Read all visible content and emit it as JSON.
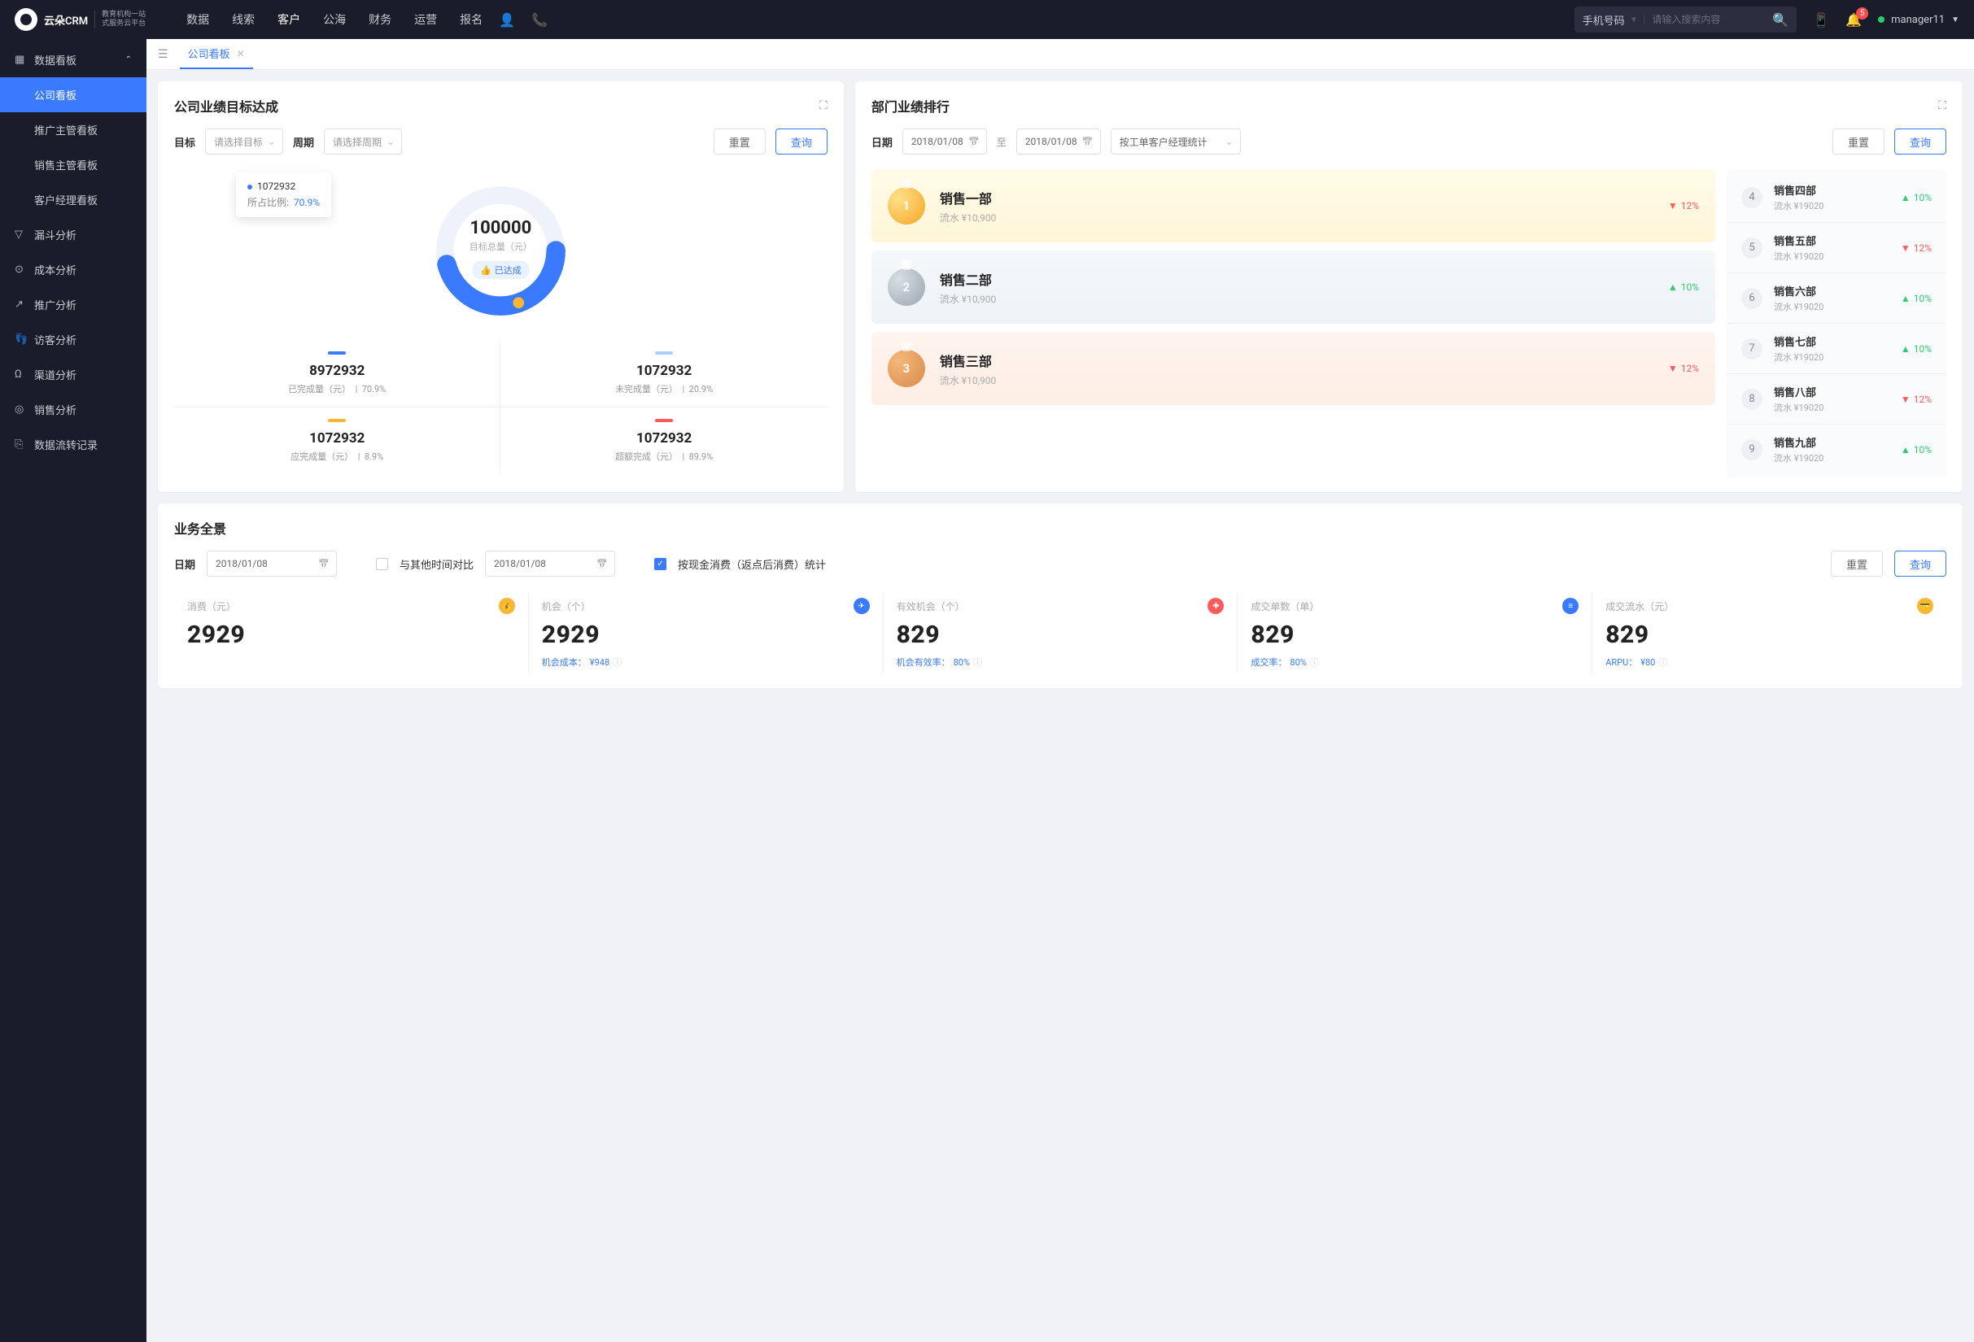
{
  "brand": {
    "name": "云朵CRM",
    "tagline1": "教育机构一站",
    "tagline2": "式服务云平台"
  },
  "topnav": {
    "items": [
      "数据",
      "线索",
      "客户",
      "公海",
      "财务",
      "运营",
      "报名"
    ],
    "activeIndex": 2
  },
  "search": {
    "type": "手机号码",
    "placeholder": "请输入搜索内容"
  },
  "topbar": {
    "notif_count": "5",
    "username": "manager11"
  },
  "sidebar": {
    "group": {
      "label": "数据看板"
    },
    "children": [
      "公司看板",
      "推广主管看板",
      "销售主管看板",
      "客户经理看板"
    ],
    "items": [
      "漏斗分析",
      "成本分析",
      "推广分析",
      "访客分析",
      "渠道分析",
      "销售分析",
      "数据流转记录"
    ],
    "activeChild": 0
  },
  "tabs": {
    "current": "公司看板"
  },
  "panel_target": {
    "title": "公司业绩目标达成",
    "filters": {
      "target_label": "目标",
      "target_ph": "请选择目标",
      "period_label": "周期",
      "period_ph": "请选择周期",
      "reset": "重置",
      "query": "查询"
    },
    "donut": {
      "total": "100000",
      "total_label": "目标总量（元）",
      "badge": "已达成"
    },
    "tooltip": {
      "value": "1072932",
      "ratio_label": "所占比例:",
      "ratio": "70.9%"
    },
    "stats": [
      {
        "value": "8972932",
        "label": "已完成量（元）",
        "pct": "70.9%",
        "color": "#3a7afe"
      },
      {
        "value": "1072932",
        "label": "未完成量（元）",
        "pct": "20.9%",
        "color": "#a9d0ff"
      },
      {
        "value": "1072932",
        "label": "应完成量（元）",
        "pct": "8.9%",
        "color": "#f7b733"
      },
      {
        "value": "1072932",
        "label": "超额完成（元）",
        "pct": "89.9%",
        "color": "#ff5b5b"
      }
    ]
  },
  "panel_rank": {
    "title": "部门业绩排行",
    "filters": {
      "date_label": "日期",
      "date_from": "2018/01/08",
      "date_to": "2018/01/08",
      "sep": "至",
      "mode": "按工单客户经理统计",
      "reset": "重置",
      "query": "查询"
    },
    "top3": [
      {
        "rank": "1",
        "name": "销售一部",
        "sub": "流水 ¥10,900",
        "pct": "12%",
        "dir": "down"
      },
      {
        "rank": "2",
        "name": "销售二部",
        "sub": "流水 ¥10,900",
        "pct": "10%",
        "dir": "up"
      },
      {
        "rank": "3",
        "name": "销售三部",
        "sub": "流水 ¥10,900",
        "pct": "12%",
        "dir": "down"
      }
    ],
    "rest": [
      {
        "rank": "4",
        "name": "销售四部",
        "sub": "流水 ¥19020",
        "pct": "10%",
        "dir": "up"
      },
      {
        "rank": "5",
        "name": "销售五部",
        "sub": "流水 ¥19020",
        "pct": "12%",
        "dir": "down"
      },
      {
        "rank": "6",
        "name": "销售六部",
        "sub": "流水 ¥19020",
        "pct": "10%",
        "dir": "up"
      },
      {
        "rank": "7",
        "name": "销售七部",
        "sub": "流水 ¥19020",
        "pct": "10%",
        "dir": "up"
      },
      {
        "rank": "8",
        "name": "销售八部",
        "sub": "流水 ¥19020",
        "pct": "12%",
        "dir": "down"
      },
      {
        "rank": "9",
        "name": "销售九部",
        "sub": "流水 ¥19020",
        "pct": "10%",
        "dir": "up"
      }
    ]
  },
  "panel_overview": {
    "title": "业务全景",
    "filters": {
      "date_label": "日期",
      "date": "2018/01/08",
      "compare_label": "与其他时间对比",
      "date2": "2018/01/08",
      "opt_label": "按现金消费（返点后消费）统计",
      "reset": "重置",
      "query": "查询"
    },
    "cards": [
      {
        "title": "消费（元）",
        "value": "2929",
        "sub": "",
        "icon": "💰",
        "color": "#f7b733"
      },
      {
        "title": "机会（个）",
        "value": "2929",
        "sub_label": "机会成本：",
        "sub_val": "¥948",
        "icon": "✈",
        "color": "#3a7afe"
      },
      {
        "title": "有效机会（个）",
        "value": "829",
        "sub_label": "机会有效率：",
        "sub_val": "80%",
        "icon": "✚",
        "color": "#ff5b5b"
      },
      {
        "title": "成交单数（单）",
        "value": "829",
        "sub_label": "成交率：",
        "sub_val": "80%",
        "icon": "≡",
        "color": "#3a7afe"
      },
      {
        "title": "成交流水（元）",
        "value": "829",
        "sub_label": "ARPU：",
        "sub_val": "¥80",
        "icon": "💳",
        "color": "#f7b733"
      }
    ]
  },
  "chart_data": {
    "type": "pie",
    "title": "公司业绩目标达成",
    "total_label": "目标总量（元）",
    "total": 100000,
    "series": [
      {
        "name": "已完成量",
        "value": 8972932,
        "pct": 70.9,
        "color": "#3a7afe"
      },
      {
        "name": "未完成量",
        "value": 1072932,
        "pct": 20.9,
        "color": "#a9d0ff"
      },
      {
        "name": "应完成量",
        "value": 1072932,
        "pct": 8.9,
        "color": "#f7b733"
      },
      {
        "name": "超额完成",
        "value": 1072932,
        "pct": 89.9,
        "color": "#ff5b5b"
      }
    ]
  }
}
